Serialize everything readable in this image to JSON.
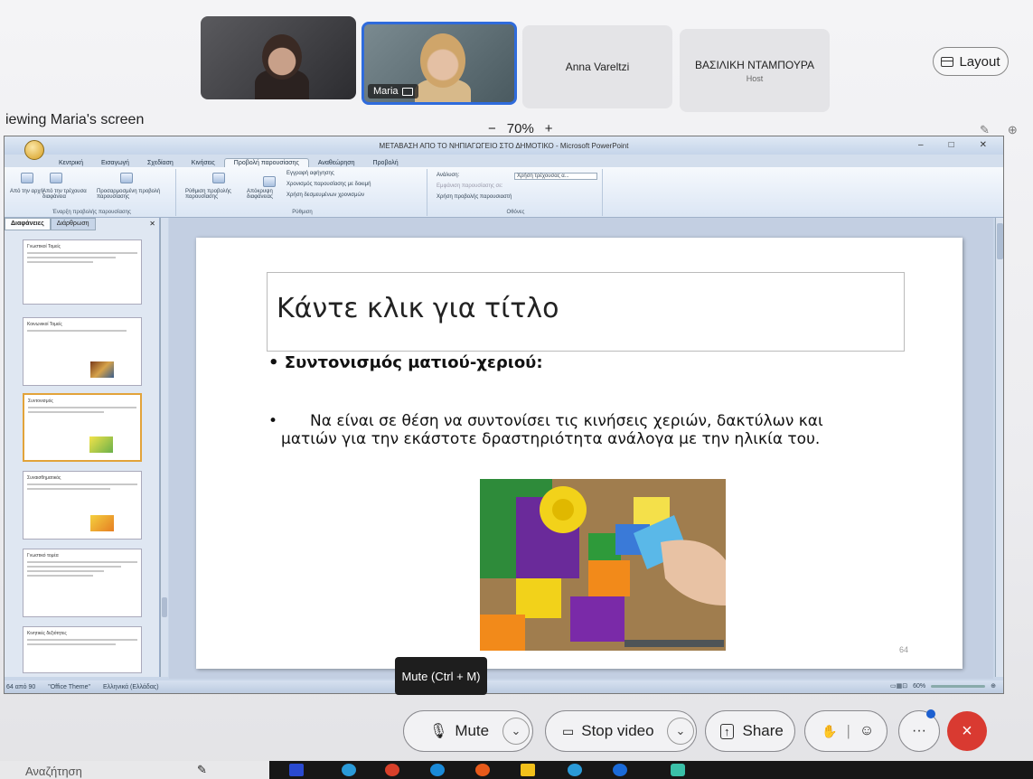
{
  "participants": [
    {
      "name": "",
      "type": "video"
    },
    {
      "name": "Maria",
      "type": "video",
      "active": true,
      "sharing": true
    },
    {
      "name": "Anna Vareltzi",
      "role": "",
      "type": "plain"
    },
    {
      "name": "ΒΑΣΙΛΙΚΗ ΝΤΑΜΠΟΥΡΑ",
      "role": "Host",
      "type": "plain"
    }
  ],
  "layout_label": "Layout",
  "viewing_label": "iewing Maria's screen",
  "zoom": {
    "minus": "−",
    "value": "70%",
    "plus": "+"
  },
  "powerpoint": {
    "window_title": "ΜΕΤΑΒΑΣΗ ΑΠΟ ΤΟ ΝΗΠΙΑΓΩΓΕΙΟ ΣΤΟ ΔΗΜΟΤΙΚΟ - Microsoft PowerPoint",
    "tabs": [
      "Κεντρική",
      "Εισαγωγή",
      "Σχεδίαση",
      "Κινήσεις",
      "Προβολή παρουσίασης",
      "Αναθεώρηση",
      "Προβολή"
    ],
    "active_tab": "Προβολή παρουσίασης",
    "ribbon": {
      "group1_items": [
        "Από την αρχή",
        "Από την τρέχουσα διαφάνεια",
        "Προσαρμοσμένη προβολή παρουσίασης"
      ],
      "group1_label": "Έναρξη προβολής παρουσίασης",
      "group2_items": [
        "Ρύθμιση προβολής παρουσίασης",
        "Απόκρυψη διαφάνειας",
        "Εγγραφή αφήγησης",
        "Χρονισμός παρουσίασης με δοκιμή",
        "Χρήση δεσμευμένων χρονισμών"
      ],
      "group2_label": "Ρύθμιση",
      "group3_items": [
        "Ανάλυση:",
        "Χρήση τρέχουσας α...",
        "Εμφάνιση παρουσίασης σε:",
        "Χρήση προβολής παρουσιαστή"
      ],
      "group3_label": "Οθόνες"
    },
    "left_tabs": [
      "Διαφάνειες",
      "Διάρθρωση"
    ],
    "thumbnails": [
      {
        "title": "Γνωστικοί Τομείς"
      },
      {
        "title": "Κοινωνικοί Τομείς"
      },
      {
        "title": "Συντονισμός"
      },
      {
        "title": "Συναισθηματικός"
      },
      {
        "title": "Γνωστικό τομέα"
      },
      {
        "title": "Κινητικές δεξιότητες"
      }
    ],
    "slide": {
      "title": "Κάντε κλικ για τίτλο",
      "bullet1": "Συντονισμός ματιού-χεριού:",
      "bullet2_line1": "Να είναι σε θέση να συντονίσει τις κινήσεις χεριών, δακτύλων και",
      "bullet2_line2": "ματιών για την εκάστοτε δραστηριότητα  ανάλογα με  την ηλικία του.",
      "page_number": "64"
    },
    "status": {
      "slide_counter": "64 από 90",
      "theme": "\"Office Theme\"",
      "language": "Ελληνικά (Ελλάδας)",
      "zoom": "60%"
    }
  },
  "tooltip": "Mute (Ctrl + M)",
  "controls": {
    "mute": "Mute",
    "stop_video": "Stop video",
    "share": "Share",
    "more": "···",
    "leave": "×"
  },
  "taskbar": {
    "search_placeholder": "Αναζήτηση"
  },
  "colors": {
    "accent": "#2f6bdc",
    "leave": "#d93a31",
    "tooltip_bg": "#1e1e1e"
  }
}
